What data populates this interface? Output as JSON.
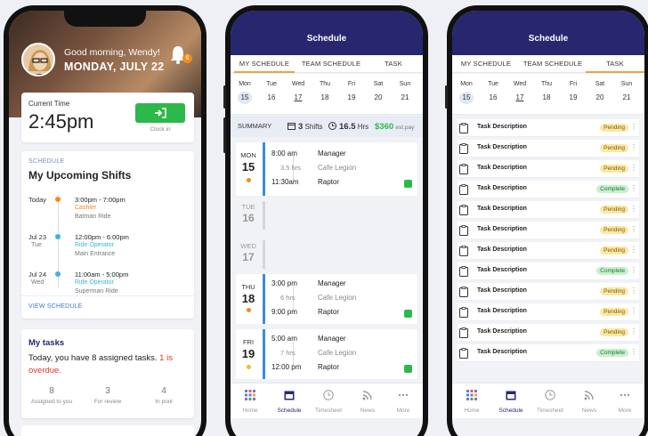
{
  "home": {
    "greeting": "Good morning, Wendy!",
    "date": "MONDAY, JULY 22",
    "notification_count": "6",
    "current_time_label": "Current Time",
    "current_time": "2:45pm",
    "clock_in_label": "Clock in",
    "schedule_section": "SCHEDULE",
    "upcoming_title": "My Upcoming Shifts",
    "shifts": [
      {
        "date": "Today",
        "weekday": "",
        "time": "3:00pm - 7:00pm",
        "role": "Cashier",
        "location": "Batman Ride",
        "color": "#f28b1e"
      },
      {
        "date": "Jul 23",
        "weekday": "Tue",
        "time": "12:00pm - 6:00pm",
        "role": "Ride Operator",
        "location": "Main Entrance",
        "color": "#3bb6d6"
      },
      {
        "date": "Jul 24",
        "weekday": "Wed",
        "time": "11:00am - 5:00pm",
        "role": "Ride Operator",
        "location": "Superman Ride",
        "color": "#3bb6d6"
      }
    ],
    "view_schedule": "VIEW SCHEDULE",
    "tasks_title": "My tasks",
    "tasks_message": "Today, you have 8 assigned tasks.",
    "tasks_overdue": "1 is overdue.",
    "stats": [
      {
        "value": "8",
        "label": "Assigned to you"
      },
      {
        "value": "3",
        "label": "For review"
      },
      {
        "value": "4",
        "label": "In pool"
      }
    ]
  },
  "schedule": {
    "title": "Schedule",
    "tabs": [
      "MY SCHEDULE",
      "TEAM SCHEDULE",
      "TASK"
    ],
    "week": [
      {
        "name": "Mon",
        "num": "15"
      },
      {
        "name": "Tue",
        "num": "16"
      },
      {
        "name": "Wed",
        "num": "17"
      },
      {
        "name": "Thu",
        "num": "18"
      },
      {
        "name": "Fri",
        "num": "19"
      },
      {
        "name": "Sat",
        "num": "20"
      },
      {
        "name": "Sun",
        "num": "21"
      }
    ],
    "summary": {
      "label": "SUMMARY",
      "shifts_value": "3",
      "shifts_unit": "Shifts",
      "hours_value": "16.5",
      "hours_unit": "Hrs",
      "pay_value": "$360",
      "pay_unit": "est.pay"
    },
    "entries": [
      {
        "weekday": "MON",
        "day": "15",
        "start": "8:00 am",
        "duration": "3.5 hrs",
        "end": "11:30am",
        "role": "Manager",
        "location": "Cafe Legion",
        "vehicle": "Raptor"
      },
      {
        "weekday": "THU",
        "day": "18",
        "start": "3:00 pm",
        "duration": "6 hrs",
        "end": "9:00 pm",
        "role": "Manager",
        "location": "Cafe Legion",
        "vehicle": "Raptor"
      },
      {
        "weekday": "FRI",
        "day": "19",
        "start": "5:00 am",
        "duration": "7 hrs",
        "end": "12:00 pm",
        "role": "Manager",
        "location": "Cafe Legion",
        "vehicle": "Raptor"
      }
    ],
    "empty_days": [
      {
        "weekday": "TUE",
        "day": "16"
      },
      {
        "weekday": "WED",
        "day": "17"
      }
    ]
  },
  "tasks": {
    "title": "Schedule",
    "items": [
      {
        "desc": "Task Description",
        "status": "Pending"
      },
      {
        "desc": "Task Description",
        "status": "Pending"
      },
      {
        "desc": "Task Description",
        "status": "Pending"
      },
      {
        "desc": "Task Description",
        "status": "Complete"
      },
      {
        "desc": "Task Description",
        "status": "Pending"
      },
      {
        "desc": "Task Description",
        "status": "Pending"
      },
      {
        "desc": "Task Description",
        "status": "Pending"
      },
      {
        "desc": "Task Description",
        "status": "Complete"
      },
      {
        "desc": "Task Description",
        "status": "Pending"
      },
      {
        "desc": "Task Description",
        "status": "Pending"
      },
      {
        "desc": "Task Description",
        "status": "Pending"
      },
      {
        "desc": "Task Description",
        "status": "Complete"
      }
    ]
  },
  "nav": [
    {
      "label": "Home",
      "icon": "grid-icon"
    },
    {
      "label": "Schedule",
      "icon": "calendar-icon"
    },
    {
      "label": "Timesheet",
      "icon": "clock-icon"
    },
    {
      "label": "News",
      "icon": "rss-icon"
    },
    {
      "label": "More",
      "icon": "more-icon"
    }
  ],
  "colors": {
    "header": "#27266e",
    "accent_green": "#2db84b",
    "accent_orange": "#f28b1e",
    "accent_blue": "#3a8be0"
  }
}
